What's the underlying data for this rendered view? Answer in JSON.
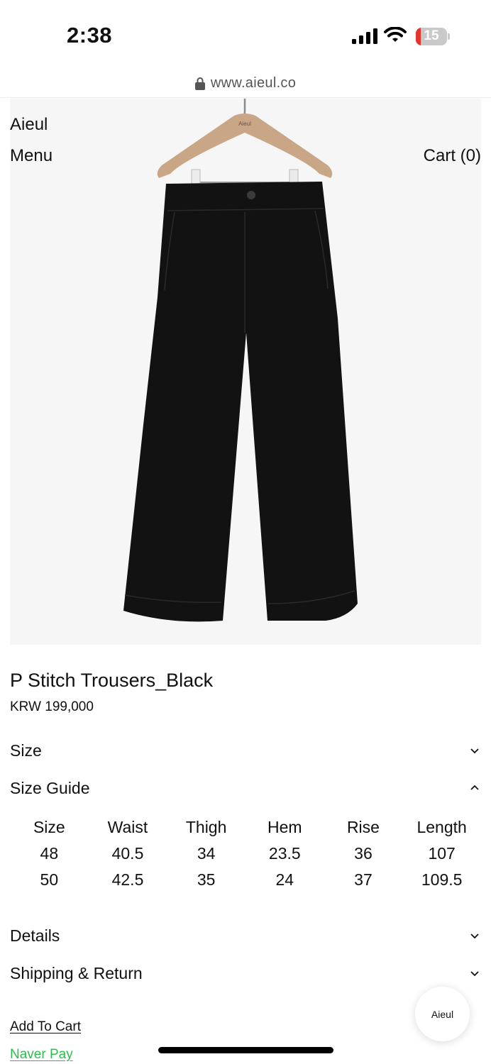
{
  "status_bar": {
    "time": "2:38",
    "battery_level": "15",
    "battery_fraction": 0.15,
    "icons": [
      "signal-icon",
      "wifi-icon",
      "battery-icon"
    ]
  },
  "browser": {
    "url": "www.aieul.co",
    "icon": "lock-icon"
  },
  "header": {
    "logo": "Aieul",
    "menu_label": "Menu",
    "cart_label": "Cart (0)"
  },
  "product": {
    "image": {
      "alt": "P Stitch Trousers_Black",
      "hanger_label": "Aieul",
      "garment_color": "#121212",
      "hanger_color": "#c9a686",
      "background_color": "#f6f6f6"
    },
    "title": "P Stitch Trousers_Black",
    "price": "KRW 199,000"
  },
  "accordions": {
    "size": {
      "label": "Size",
      "icon": "chevron-down-icon"
    },
    "size_guide": {
      "label": "Size Guide",
      "icon": "chevron-up-icon"
    },
    "details": {
      "label": "Details",
      "icon": "chevron-down-icon"
    },
    "shipping": {
      "label": "Shipping & Return",
      "icon": "chevron-down-icon"
    }
  },
  "size_guide": {
    "columns": [
      "Size",
      "Waist",
      "Thigh",
      "Hem",
      "Rise",
      "Length"
    ],
    "rows": [
      [
        "48",
        "40.5",
        "34",
        "23.5",
        "36",
        "107"
      ],
      [
        "50",
        "42.5",
        "35",
        "24",
        "37",
        "109.5"
      ]
    ]
  },
  "actions": {
    "add_to_cart": "Add To Cart",
    "naver_pay": "Naver Pay",
    "naver_pay_color": "#2dbd4d"
  },
  "chat_widget": {
    "label": "Aieul"
  }
}
